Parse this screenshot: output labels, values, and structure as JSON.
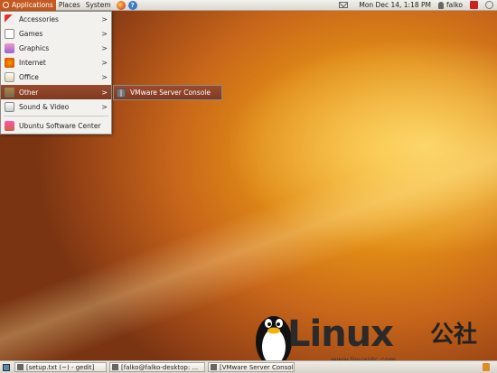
{
  "top_panel": {
    "menus": [
      "Applications",
      "Places",
      "System"
    ],
    "clock": "Mon Dec 14,  1:18 PM",
    "user": "falko"
  },
  "app_menu": {
    "items": [
      {
        "label": "Accessories",
        "icon": "accessories-icon"
      },
      {
        "label": "Games",
        "icon": "games-icon"
      },
      {
        "label": "Graphics",
        "icon": "graphics-icon"
      },
      {
        "label": "Internet",
        "icon": "internet-icon"
      },
      {
        "label": "Office",
        "icon": "office-icon"
      },
      {
        "label": "Other",
        "icon": "other-icon",
        "highlighted": true
      },
      {
        "label": "Sound & Video",
        "icon": "sound-video-icon"
      }
    ],
    "footer_item": "Ubuntu Software Center"
  },
  "submenu": {
    "items": [
      "VMware Server Console"
    ]
  },
  "taskbar": {
    "tasks": [
      "[setup.txt (~) - gedit]",
      "[falko@falko-desktop: ...",
      "[VMware Server Console..."
    ]
  },
  "watermark": {
    "text": "Linux",
    "cn": "公社",
    "url": "www.linuxidc.com"
  },
  "colors": {
    "highlight": "#8a4228",
    "desktop": "#e08a16"
  }
}
